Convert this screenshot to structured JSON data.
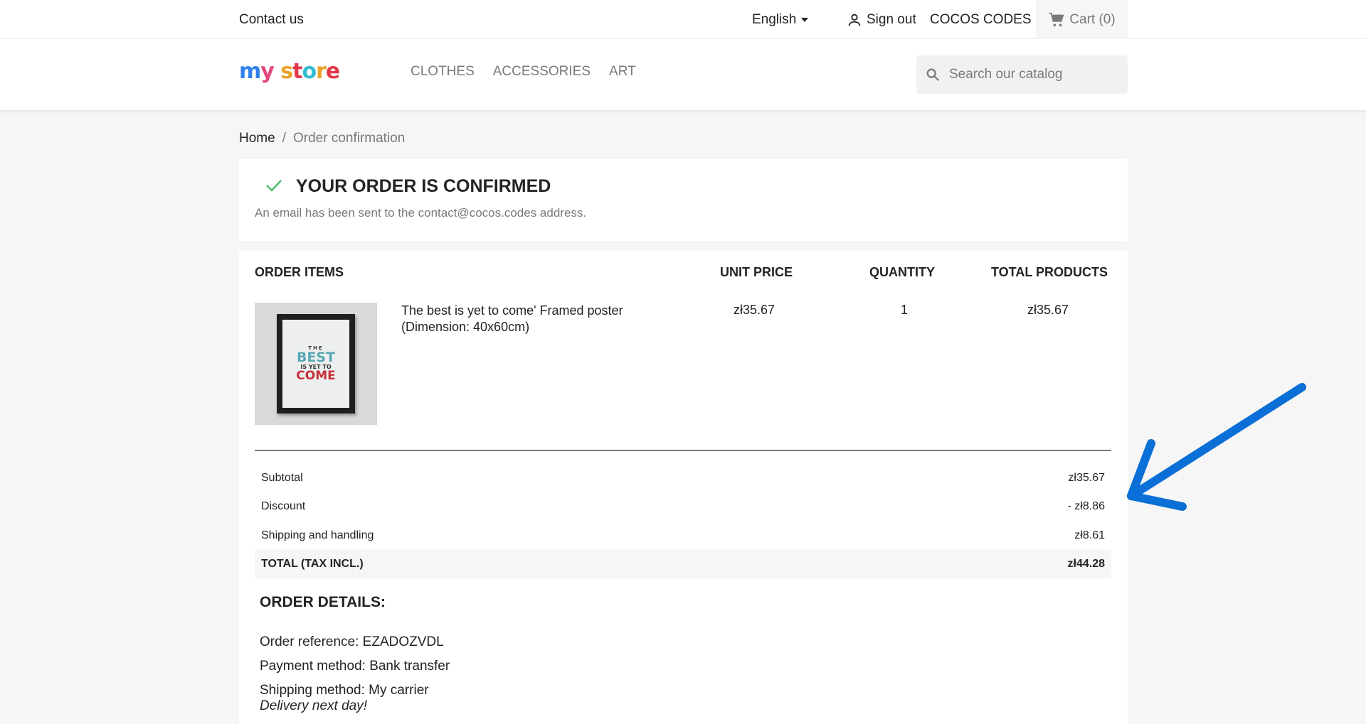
{
  "topbar": {
    "contact": "Contact us",
    "language": "English",
    "signout": "Sign out",
    "account": "COCOS CODES",
    "cart": "Cart (0)"
  },
  "header": {
    "logo": "my store",
    "nav": [
      "CLOTHES",
      "ACCESSORIES",
      "ART"
    ],
    "search_placeholder": "Search our catalog"
  },
  "breadcrumb": {
    "home": "Home",
    "separator": "/",
    "current": "Order confirmation"
  },
  "confirmation": {
    "title": "YOUR ORDER IS CONFIRMED",
    "message": "An email has been sent to the contact@cocos.codes address."
  },
  "order": {
    "headers": {
      "items": "ORDER ITEMS",
      "unit_price": "UNIT PRICE",
      "quantity": "QUANTITY",
      "total": "TOTAL PRODUCTS"
    },
    "item": {
      "name_line1": "The best is yet to come' Framed poster",
      "name_line2": "(Dimension: 40x60cm)",
      "unit_price": "zł35.67",
      "quantity": "1",
      "total": "zł35.67",
      "poster_text": [
        "THE",
        "BEST",
        "IS YET TO",
        "COME"
      ]
    },
    "summary": {
      "subtotal_label": "Subtotal",
      "subtotal_value": "zł35.67",
      "discount_label": "Discount",
      "discount_value": "- zł8.86",
      "shipping_label": "Shipping and handling",
      "shipping_value": "zł8.61",
      "total_label": "TOTAL (TAX INCL.)",
      "total_value": "zł44.28"
    }
  },
  "details": {
    "title": "ORDER DETAILS:",
    "reference": "Order reference: EZADOZVDL",
    "payment": "Payment method: Bank transfer",
    "shipping": "Shipping method: My carrier",
    "delivery": "Delivery next day!"
  },
  "colors": {
    "accent_green": "#4cbb6c",
    "annotation_arrow": "#0a6fd6"
  }
}
